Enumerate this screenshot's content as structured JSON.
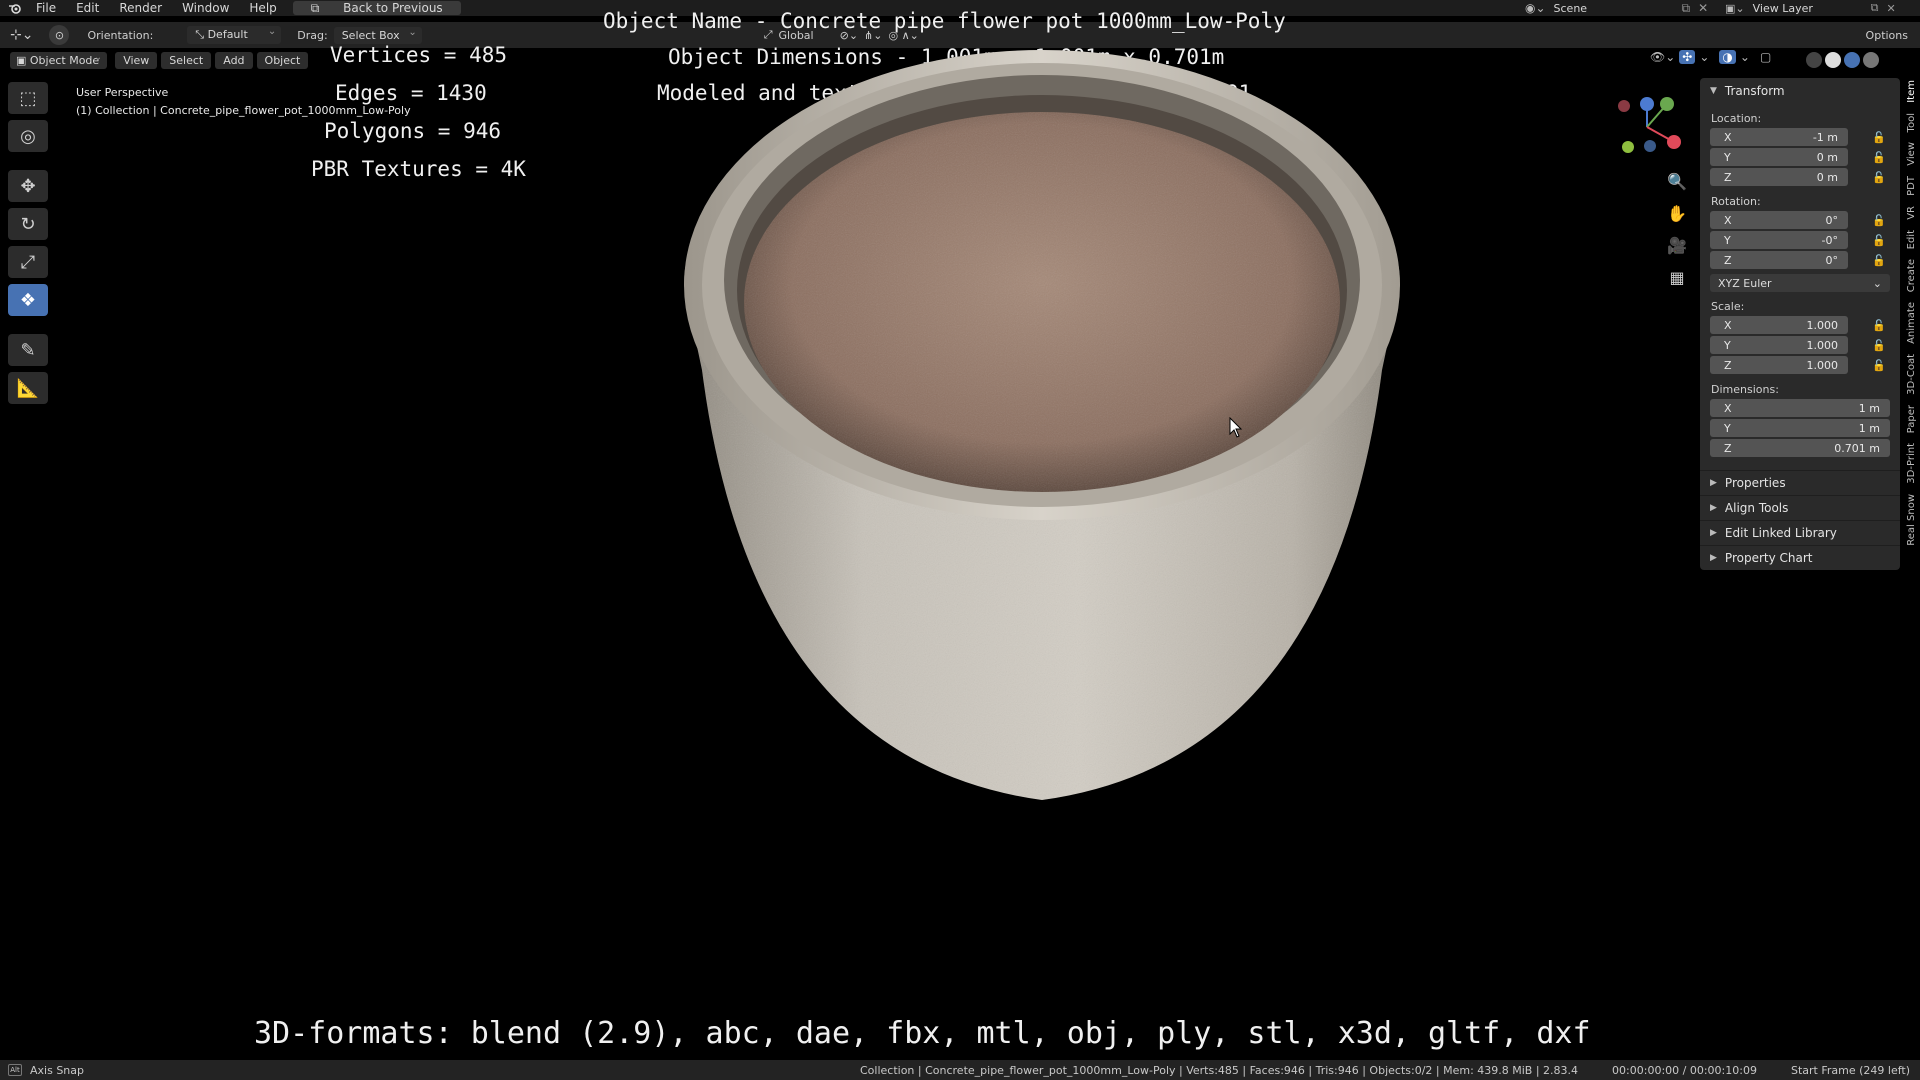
{
  "topbar": {
    "menu": [
      "File",
      "Edit",
      "Render",
      "Window",
      "Help"
    ],
    "back_button": "Back to Previous",
    "scene_label": "Scene",
    "view_layer_label": "View Layer"
  },
  "header": {
    "orientation_label": "Orientation:",
    "orientation_value": "Default",
    "drag_label": "Drag:",
    "drag_value": "Select Box",
    "transform_orientation": "Global",
    "options_label": "Options"
  },
  "header2": {
    "mode": "Object Mode",
    "menus": [
      "View",
      "Select",
      "Add",
      "Object"
    ]
  },
  "viewport": {
    "perspective": "User Perspective",
    "collection_info": "(1) Collection | Concrete_pipe_flower_pot_1000mm_Low-Poly"
  },
  "overlay": {
    "vertices": "Vertices = 485",
    "edges": "Edges = 1430",
    "polygons": "Polygons = 946",
    "textures": "PBR Textures = 4K",
    "object_name": "Object Name - Concrete pipe flower pot 1000mm_Low-Poly",
    "dimensions": "Object Dimensions -  1.001m x 1.001m x 0.701m",
    "modeled_by": "Modeled and textured by 3DHaupt in Blender-2.91",
    "formats": "3D-formats: blend (2.9), abc, dae, fbx, mtl, obj, ply, stl, x3d, gltf, dxf"
  },
  "npanel": {
    "transform_title": "Transform",
    "location_label": "Location:",
    "location": [
      {
        "axis": "X",
        "value": "-1 m"
      },
      {
        "axis": "Y",
        "value": "0 m"
      },
      {
        "axis": "Z",
        "value": "0 m"
      }
    ],
    "rotation_label": "Rotation:",
    "rotation": [
      {
        "axis": "X",
        "value": "0°"
      },
      {
        "axis": "Y",
        "value": "-0°"
      },
      {
        "axis": "Z",
        "value": "0°"
      }
    ],
    "rotation_mode": "XYZ Euler",
    "scale_label": "Scale:",
    "scale": [
      {
        "axis": "X",
        "value": "1.000"
      },
      {
        "axis": "Y",
        "value": "1.000"
      },
      {
        "axis": "Z",
        "value": "1.000"
      }
    ],
    "dimensions_label": "Dimensions:",
    "dimensions": [
      {
        "axis": "X",
        "value": "1 m"
      },
      {
        "axis": "Y",
        "value": "1 m"
      },
      {
        "axis": "Z",
        "value": "0.701 m"
      }
    ],
    "subpanels": [
      "Properties",
      "Align Tools",
      "Edit Linked Library",
      "Property Chart"
    ]
  },
  "vtabs": [
    "Item",
    "Tool",
    "View",
    "PDT",
    "VR",
    "Edit",
    "Create",
    "Animate",
    "3D-Coat",
    "Paper",
    "3D-Print",
    "Real Snow"
  ],
  "statusbar": {
    "left": "Axis Snap",
    "info": "Collection | Concrete_pipe_flower_pot_1000mm_Low-Poly | Verts:485 | Faces:946 | Tris:946 | Objects:0/2 | Mem: 439.8 MiB | 2.83.4",
    "time": "00:00:00:00 / 00:00:10:09",
    "frame": "Start Frame (249 left)"
  },
  "colors": {
    "accent": "#4772b3",
    "background": "#000000",
    "panel": "#2a2a2a"
  }
}
